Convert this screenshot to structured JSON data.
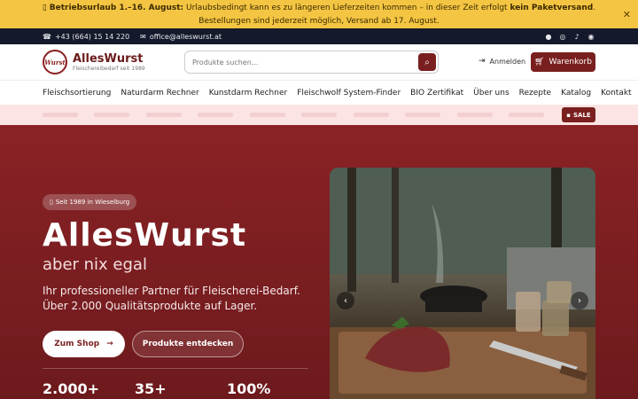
{
  "notice": {
    "icon": "info-icon",
    "bold_lead": "Betriebsurlaub 1.–16. August:",
    "text_1": " Urlaubsbedingt kann es zu längeren Lieferzeiten kommen – in dieser Zeit erfolgt ",
    "bold_mid": "kein Paketversand",
    "text_2": ". Bestellungen sind jederzeit möglich, Versand ab 17. August.",
    "close_symbol": "✕"
  },
  "contact": {
    "phone": "+43 (664) 15 14 220",
    "email": "office@alleswurst.at",
    "social": [
      "facebook-icon",
      "instagram-icon",
      "tiktok-icon",
      "whatsapp-icon"
    ]
  },
  "header": {
    "logo_badge": "Wurst",
    "logo_name": "AllesWurst",
    "logo_sub": "Fleischereibedarf seit 1989",
    "search_placeholder": "Produkte suchen...",
    "login_label": "Anmelden",
    "cart_label": "Warenkorb"
  },
  "nav": {
    "items": [
      "Fleischsortierung",
      "Naturdarm Rechner",
      "Kunstdarm Rechner",
      "Fleischwolf System-Finder",
      "BIO Zertifikat",
      "Über uns",
      "Rezepte",
      "Katalog",
      "Kontakt"
    ]
  },
  "categories": {
    "sale_label": "SALE"
  },
  "hero": {
    "badge": "Seit 1989 in Wieselburg",
    "title": "AllesWurst",
    "subtitle": "aber nix egal",
    "description": "Ihr professioneller Partner für Fleischerei-Bedarf. Über 2.000 Qualitätsprodukte auf Lager.",
    "btn_shop": "Zum Shop",
    "btn_products": "Produkte entdecken",
    "stats": [
      "2.000+",
      "35+",
      "100%"
    ]
  },
  "colors": {
    "notice_bg": "#f4c542",
    "contact_bg": "#141a2b",
    "brand": "#7a1f1f",
    "hero_bg": "#8a2225",
    "category_strip": "#fce4e4"
  }
}
